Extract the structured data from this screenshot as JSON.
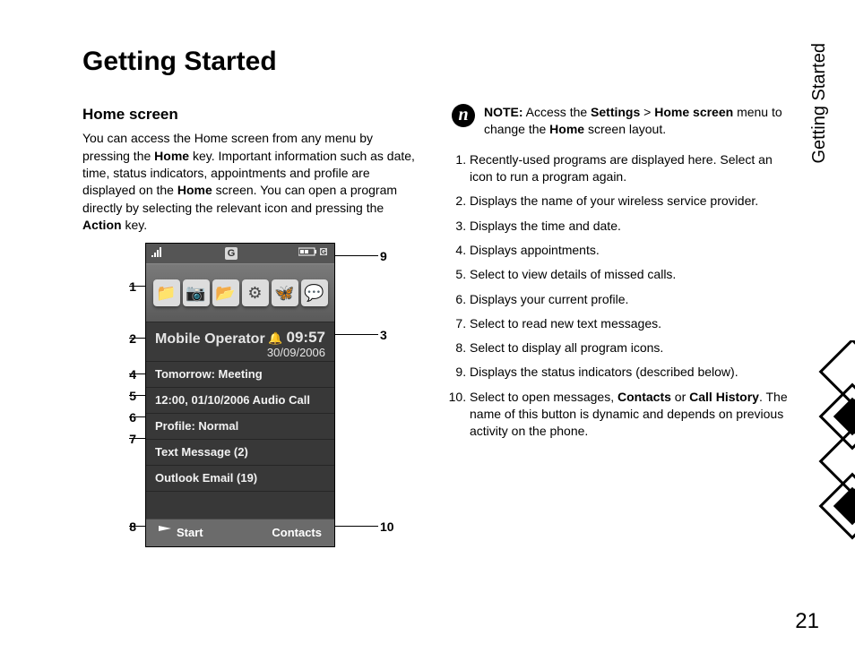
{
  "page": {
    "title": "Getting Started",
    "side_tab": "Getting Started",
    "number": "21"
  },
  "left": {
    "subhead": "Home screen",
    "intro_pre": "You can access the Home screen from any menu by pressing the ",
    "intro_b1": "Home",
    "intro_mid": " key. Important information such as date, time, status indicators, appointments and profile are displayed on the ",
    "intro_b2": "Home",
    "intro_mid2": " screen. You can open a program directly by selecting the relevant icon and pressing the ",
    "intro_b3": "Action",
    "intro_post": " key."
  },
  "phone": {
    "status_g": "G",
    "operator": "Mobile Operator",
    "time": "09:57",
    "date": "30/09/2006",
    "row_appt": "Tomorrow: Meeting",
    "row_call": "12:00, 01/10/2006 Audio Call",
    "row_profile": "Profile: Normal",
    "row_text": "Text Message (2)",
    "row_email": "Outlook Email (19)",
    "soft_left": "Start",
    "soft_right": "Contacts"
  },
  "callouts": {
    "l1": "1",
    "l2": "2",
    "l3": "3",
    "l4": "4",
    "l5": "5",
    "l6": "6",
    "l7": "7",
    "l8": "8",
    "l9": "9",
    "l10": "10"
  },
  "note": {
    "lead": "NOTE:",
    "t1": " Access the ",
    "b1": "Settings",
    "t2": " > ",
    "b2": "Home screen",
    "t3": " menu to change the ",
    "b3": "Home",
    "t4": " screen layout."
  },
  "list": {
    "i1": "Recently-used programs are displayed here. Select an icon to run a program again.",
    "i2": "Displays the name of your wireless service provider.",
    "i3": "Displays the time and date.",
    "i4": "Displays appointments.",
    "i5": "Select to view details of missed calls.",
    "i6": "Displays your current profile.",
    "i7": "Select to read new text messages.",
    "i8": "Select to display all program icons.",
    "i9": "Displays the status indicators (described below).",
    "i10_pre": "Select to open messages, ",
    "i10_b1": "Contacts",
    "i10_mid": " or ",
    "i10_b2": "Call History",
    "i10_post": ". The name of this button is dynamic and depends on previous activity on the phone."
  }
}
